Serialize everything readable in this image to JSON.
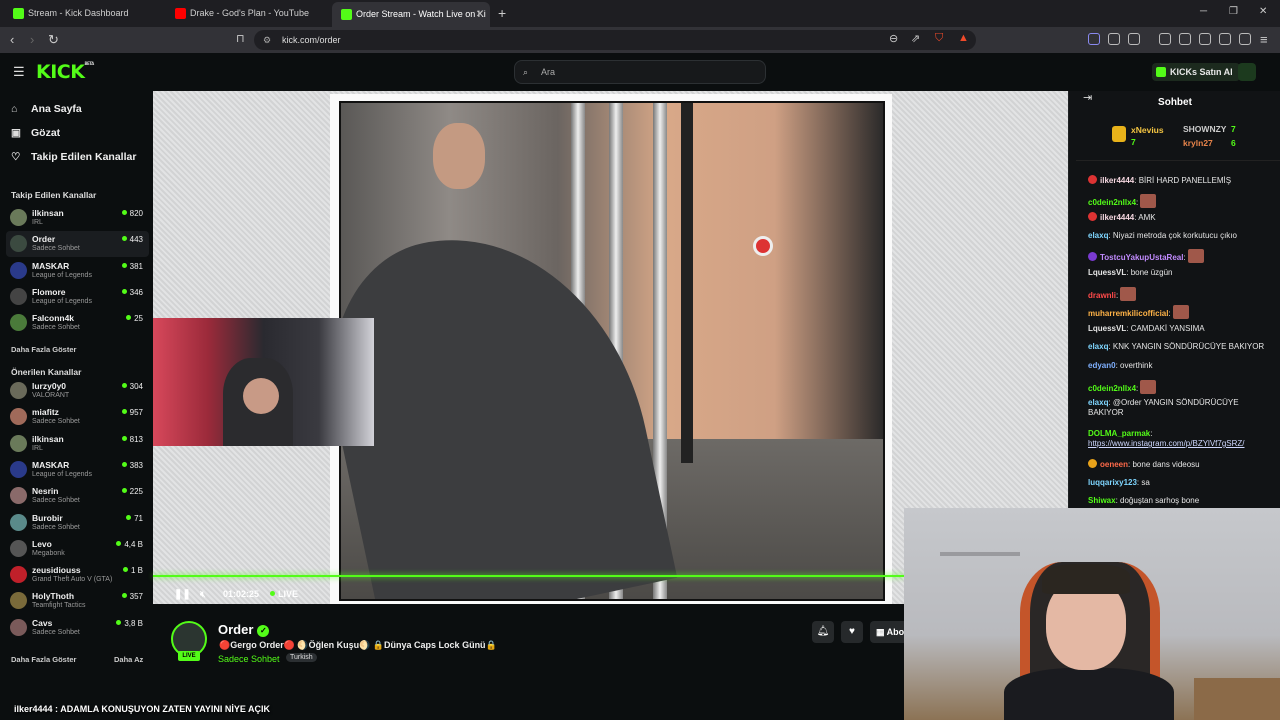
{
  "browser": {
    "tabs": [
      {
        "label": "Stream - Kick Dashboard",
        "favicon_color": "#53fc18"
      },
      {
        "label": "Drake - God's Plan - YouTube",
        "favicon_color": "#ff0000"
      },
      {
        "label": "Order Stream - Watch Live on Ki",
        "favicon_color": "#53fc18",
        "active": true
      }
    ],
    "url": "kick.com/order"
  },
  "header": {
    "logo": "KICK",
    "logo_sup": "BETA",
    "search_placeholder": "Ara",
    "kicks_button": "KICKs Satın Al"
  },
  "sidebar": {
    "nav": [
      {
        "label": "Ana Sayfa",
        "icon": "home-icon"
      },
      {
        "label": "Gözat",
        "icon": "browse-icon"
      },
      {
        "label": "Takip Edilen Kanallar",
        "icon": "heart-icon"
      }
    ],
    "followed_title": "Takip Edilen Kanallar",
    "followed": [
      {
        "name": "ilkinsan",
        "category": "IRL",
        "viewers": "820",
        "color": "#6a7a5a"
      },
      {
        "name": "Order",
        "category": "Sadece Sohbet",
        "viewers": "443",
        "color": "#3b4a40"
      },
      {
        "name": "MASKAR",
        "category": "League of Legends",
        "viewers": "381",
        "color": "#2a3a8a"
      },
      {
        "name": "Flomore",
        "category": "League of Legends",
        "viewers": "346",
        "color": "#444"
      },
      {
        "name": "Falconn4k",
        "category": "Sadece Sohbet",
        "viewers": "25",
        "color": "#4a7a3a"
      }
    ],
    "show_more_1": "Daha Fazla Göster",
    "recommended_title": "Önerilen Kanallar",
    "recommended": [
      {
        "name": "lurzy0y0",
        "category": "VALORANT",
        "viewers": "304",
        "color": "#6a6a5a"
      },
      {
        "name": "miafitz",
        "category": "Sadece Sohbet",
        "viewers": "957",
        "color": "#a06a5a"
      },
      {
        "name": "ilkinsan",
        "category": "IRL",
        "viewers": "813",
        "color": "#6a7a5a"
      },
      {
        "name": "MASKAR",
        "category": "League of Legends",
        "viewers": "383",
        "color": "#2a3a8a"
      },
      {
        "name": "Nesrin",
        "category": "Sadece Sohbet",
        "viewers": "225",
        "color": "#8a6a6a"
      },
      {
        "name": "Burobir",
        "category": "Sadece Sohbet",
        "viewers": "71",
        "color": "#5a8a8a"
      },
      {
        "name": "Levo",
        "category": "Megabonk",
        "viewers": "4,4 B",
        "color": "#555"
      },
      {
        "name": "zeusidiouss",
        "category": "Grand Theft Auto V (GTA)",
        "viewers": "1 B",
        "color": "#c0202a"
      },
      {
        "name": "HolyThoth",
        "category": "Teamfight Tactics",
        "viewers": "357",
        "color": "#7a6a3a"
      },
      {
        "name": "Cavs",
        "category": "Sadece Sohbet",
        "viewers": "3,8 B",
        "color": "#7a5a5a"
      }
    ],
    "show_more_2": "Daha Fazla Göster",
    "show_less": "Daha Az"
  },
  "player": {
    "time": "01:02:25",
    "live": "LIVE",
    "progress_pct": 100
  },
  "stream": {
    "name": "Order",
    "live_badge": "LIVE",
    "title": "🔴Gergo Order🔴 🌖Öğlen Kuşu🌖 🔒Dünya Caps Lock Günü🔒",
    "category": "Sadece Sohbet",
    "tag": "Turkish",
    "subscribe_label": "Abo"
  },
  "caption": "ilker4444 : ADAMLA KONUŞUYON ZATEN YAYINI NİYE AÇIK",
  "chat": {
    "title": "Sohbet",
    "pinned": {
      "top_name": "xNevius",
      "top_count": "7",
      "second_name": "SHOWNZY",
      "second_count": "7",
      "third_name": "kryln27",
      "third_count": "6"
    },
    "messages": [
      {
        "user": "ilker4444",
        "text": "BİRİ HARD PANELLEMİŞ",
        "color": "#f5d7e0",
        "badge": "#d33"
      },
      {
        "user": "c0dein2nllx4",
        "text": "",
        "color": "#53fc18",
        "emote": true
      },
      {
        "user": "ilker4444",
        "text": "AMK",
        "color": "#f5d7e0",
        "badge": "#d33"
      },
      {
        "user": "elaxq",
        "text": "Niyazi metroda çok korkutucu çıkıo",
        "color": "#7fd6ff"
      },
      {
        "user": "TostcuYakupUstaReal",
        "text": "",
        "color": "#c28bff",
        "badge": "#7a3ad0",
        "emote": true
      },
      {
        "user": "LquessVL",
        "text": "bone üzgün",
        "color": "#e6e6e6"
      },
      {
        "user": "drawnli",
        "text": "",
        "color": "#ff4a4a",
        "emote": true
      },
      {
        "user": "muharremkilicofficial",
        "text": "",
        "color": "#ffb347",
        "emote": true
      },
      {
        "user": "LquessVL",
        "text": "CAMDAKİ YANSIMA",
        "color": "#e6e6e6"
      },
      {
        "user": "elaxq",
        "text": "KNK YANGIN SÖNDÜRÜCÜYE BAKIYOR",
        "color": "#7fd6ff"
      },
      {
        "user": "edyan0",
        "text": "overthink",
        "color": "#7fb0ff"
      },
      {
        "user": "c0dein2nllx4",
        "text": "",
        "color": "#53fc18",
        "emote": true
      },
      {
        "user": "elaxq",
        "text": "@Order YANGIN SÖNDÜRÜCÜYE BAKIYOR",
        "color": "#7fd6ff"
      },
      {
        "user": "DOLMA_parmak",
        "text": "https://www.instagram.com/p/BZYlVf7gSRZ/",
        "color": "#53fc18"
      },
      {
        "user": "oeneen",
        "text": "bone dans videosu",
        "color": "#ff6a4a",
        "badge": "#e8a21a"
      },
      {
        "user": "luqqarixy123",
        "text": "sa",
        "color": "#7fd6ff"
      },
      {
        "user": "Shiwax",
        "text": "doğuştan sarhoş bone",
        "color": "#53fc18"
      }
    ]
  }
}
